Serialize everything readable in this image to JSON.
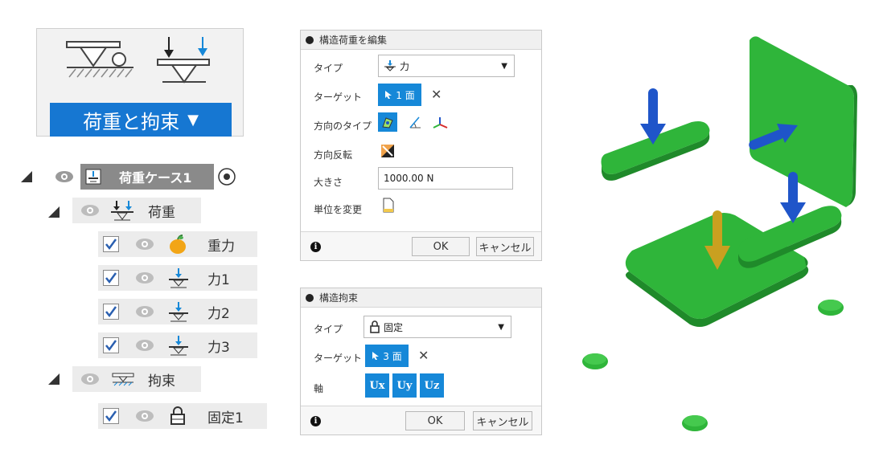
{
  "ribbon": {
    "label": "荷重と拘束",
    "caret": "▼"
  },
  "tree": {
    "load_case": {
      "label": "荷重ケース1"
    },
    "loads": {
      "label": "荷重",
      "items": [
        {
          "label": "重力"
        },
        {
          "label": "力1"
        },
        {
          "label": "力2"
        },
        {
          "label": "力3"
        }
      ]
    },
    "constraints": {
      "label": "拘束",
      "items": [
        {
          "label": "固定1"
        }
      ]
    }
  },
  "load_dialog": {
    "title": "構造荷重を編集",
    "type_label": "タイプ",
    "type_value": "力",
    "target_label": "ターゲット",
    "target_value": "1 面",
    "direction_type_label": "方向のタイプ",
    "flip_label": "方向反転",
    "magnitude_label": "大きさ",
    "magnitude_value": "1000.00 N",
    "units_label": "単位を変更",
    "ok": "OK",
    "cancel": "キャンセル"
  },
  "constraint_dialog": {
    "title": "構造拘束",
    "type_label": "タイプ",
    "type_value": "固定",
    "target_label": "ターゲット",
    "target_value": "3 面",
    "axis_label": "軸",
    "axes": [
      "Ux",
      "Uy",
      "Uz"
    ],
    "ok": "OK",
    "cancel": "キャンセル"
  },
  "colors": {
    "accent_blue": "#1688d8",
    "model_green": "#2fb53a",
    "arrow_blue": "#1f55c9",
    "arrow_gold": "#c9a020"
  }
}
